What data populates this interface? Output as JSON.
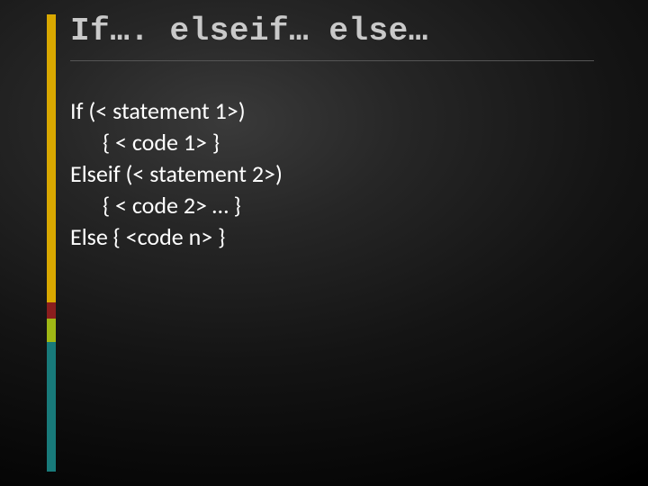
{
  "colors": {
    "accent_yellow": "#d9a800",
    "accent_red": "#8a1e1e",
    "accent_chartreuse": "#9fb815",
    "accent_teal": "#187a7a"
  },
  "title": "If…. elseif… else…",
  "body": {
    "line1": "If (< statement 1>)",
    "line2": "{ < code 1> }",
    "line3": "Elseif (< statement 2>)",
    "line4": "{ < code 2> … }",
    "line5": "Else { <code n> }"
  }
}
